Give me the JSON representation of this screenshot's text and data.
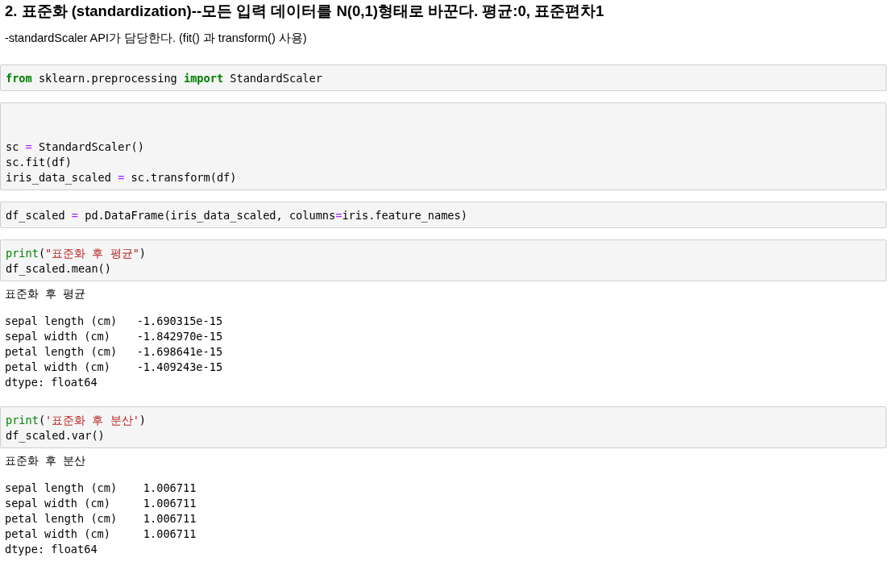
{
  "heading": "2. 표준화 (standardization)--모든 입력 데이터를 N(0,1)형태로 바꾼다. 평균:0, 표준편차1",
  "paragraph": "-standardScaler API가 담당한다. (fit() 과 transform() 사용)",
  "cells": [
    {
      "lines": [
        {
          "kind": "code",
          "tokens": [
            {
              "kind": "keyword",
              "text": "from"
            },
            {
              "kind": "plain",
              "text": " sklearn.preprocessing "
            },
            {
              "kind": "keyword",
              "text": "import"
            },
            {
              "kind": "plain",
              "text": " StandardScaler"
            }
          ]
        }
      ]
    },
    {
      "lines": [
        {
          "kind": "blank"
        },
        {
          "kind": "blank"
        },
        {
          "kind": "code",
          "tokens": [
            {
              "kind": "plain",
              "text": "sc "
            },
            {
              "kind": "operator",
              "text": "="
            },
            {
              "kind": "plain",
              "text": " StandardScaler()"
            }
          ]
        },
        {
          "kind": "code",
          "tokens": [
            {
              "kind": "plain",
              "text": "sc.fit(df)"
            }
          ]
        },
        {
          "kind": "code",
          "tokens": [
            {
              "kind": "plain",
              "text": "iris_data_scaled "
            },
            {
              "kind": "operator",
              "text": "="
            },
            {
              "kind": "plain",
              "text": " sc.transform(df)"
            }
          ]
        }
      ]
    },
    {
      "lines": [
        {
          "kind": "code",
          "tokens": [
            {
              "kind": "plain",
              "text": "df_scaled "
            },
            {
              "kind": "operator",
              "text": "="
            },
            {
              "kind": "plain",
              "text": " pd.DataFrame(iris_data_scaled, columns"
            },
            {
              "kind": "operator",
              "text": "="
            },
            {
              "kind": "plain",
              "text": "iris.feature_names)"
            }
          ]
        }
      ]
    },
    {
      "lines": [
        {
          "kind": "code",
          "tokens": [
            {
              "kind": "builtin",
              "text": "print"
            },
            {
              "kind": "plain",
              "text": "("
            },
            {
              "kind": "string",
              "text": "\"표준화 후 평균\""
            },
            {
              "kind": "plain",
              "text": ")"
            }
          ]
        },
        {
          "kind": "code",
          "tokens": [
            {
              "kind": "plain",
              "text": "df_scaled.mean()"
            }
          ]
        }
      ],
      "output": {
        "stdout": "표준화 후 평균",
        "lines": [
          "sepal length (cm)   -1.690315e-15",
          "sepal width (cm)    -1.842970e-15",
          "petal length (cm)   -1.698641e-15",
          "petal width (cm)    -1.409243e-15",
          "dtype: float64"
        ]
      }
    },
    {
      "lines": [
        {
          "kind": "code",
          "tokens": [
            {
              "kind": "builtin",
              "text": "print"
            },
            {
              "kind": "plain",
              "text": "("
            },
            {
              "kind": "string",
              "text": "'표준화 후 분산'"
            },
            {
              "kind": "plain",
              "text": ")"
            }
          ]
        },
        {
          "kind": "code",
          "tokens": [
            {
              "kind": "plain",
              "text": "df_scaled.var()"
            }
          ]
        }
      ],
      "output": {
        "stdout": "표준화 후 분산",
        "lines": [
          "sepal length (cm)    1.006711",
          "sepal width (cm)     1.006711",
          "petal length (cm)    1.006711",
          "petal width (cm)     1.006711",
          "dtype: float64"
        ]
      }
    }
  ]
}
